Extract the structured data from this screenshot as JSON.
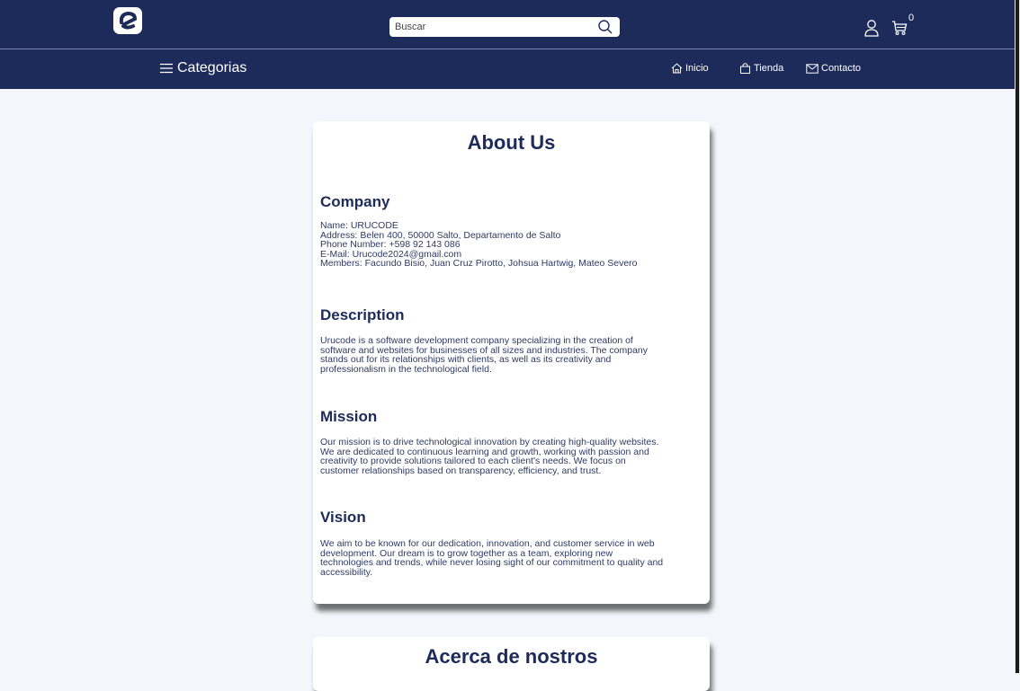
{
  "header": {
    "logo_icon": "e-logo-icon",
    "search": {
      "placeholder": "Buscar",
      "value": ""
    },
    "cart_count": "0"
  },
  "nav": {
    "categories_label": "Categorias",
    "links": [
      {
        "label": "Inicio",
        "icon": "home-icon"
      },
      {
        "label": "Tienda",
        "icon": "shopping-bag-icon"
      },
      {
        "label": "Contacto",
        "icon": "mail-icon"
      }
    ]
  },
  "about": {
    "title": "About Us",
    "company": {
      "heading": "Company",
      "lines": [
        "Name: URUCODE",
        "Address: Belen 400, 50000 Salto, Departamento de Salto",
        "Phone Number: +598 92 143 086",
        "E-Mail: Urucode2024@gmail.com",
        "Members: Facundo Bisio, Juan Cruz Pirotto, Johsua Hartwig, Mateo Severo"
      ]
    },
    "description": {
      "heading": "Description",
      "lines": [
        "Urucode is a software development company specializing in the creation of",
        "software and websites for businesses of all sizes and industries. The company",
        "stands out for its relationships with clients, as well as its creativity and",
        "professionalism in the technological field."
      ]
    },
    "mission": {
      "heading": "Mission",
      "lines": [
        "Our mission is to drive technological innovation by creating high-quality websites.",
        "We are dedicated to continuous learning and growth, working with passion and",
        "creativity to provide solutions tailored to each client's needs. We focus on",
        "customer relationships based on transparency, efficiency, and trust."
      ]
    },
    "vision": {
      "heading": "Vision",
      "lines": [
        "We aim to be known for our dedication, innovation, and customer service in web",
        "development. Our dream is to grow together as a team, exploring new",
        "technologies and trends, while never losing sight of our commitment to quality and",
        "accessibility."
      ]
    }
  },
  "acerca": {
    "title": "Acerca de nostros"
  },
  "colors": {
    "navy": "#1d2b5a",
    "page_bg": "#f4f6fb",
    "card_bg": "#ffffff"
  }
}
